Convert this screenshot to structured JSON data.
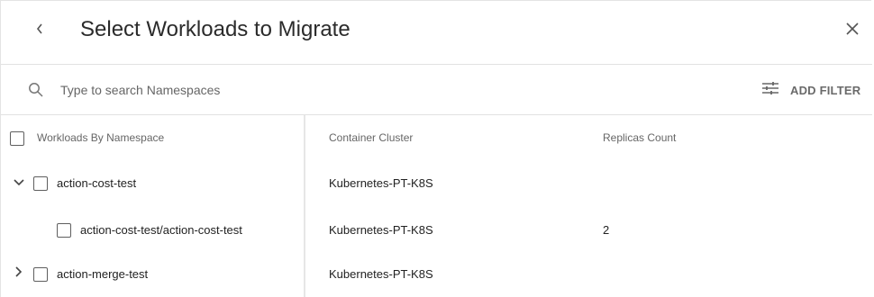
{
  "header": {
    "title": "Select Workloads to Migrate"
  },
  "search": {
    "placeholder": "Type to search Namespaces",
    "value": ""
  },
  "filter": {
    "label": "ADD FILTER"
  },
  "table": {
    "columns": {
      "workloads": "Workloads By Namespace",
      "cluster": "Container Cluster",
      "replicas": "Replicas Count"
    },
    "rows": [
      {
        "name": "action-cost-test",
        "cluster": "Kubernetes-PT-K8S",
        "replicas": "",
        "expanded": true
      },
      {
        "name": "action-cost-test/action-cost-test",
        "cluster": "Kubernetes-PT-K8S",
        "replicas": "2"
      },
      {
        "name": "action-merge-test",
        "cluster": "Kubernetes-PT-K8S",
        "replicas": "",
        "expanded": false
      }
    ]
  }
}
